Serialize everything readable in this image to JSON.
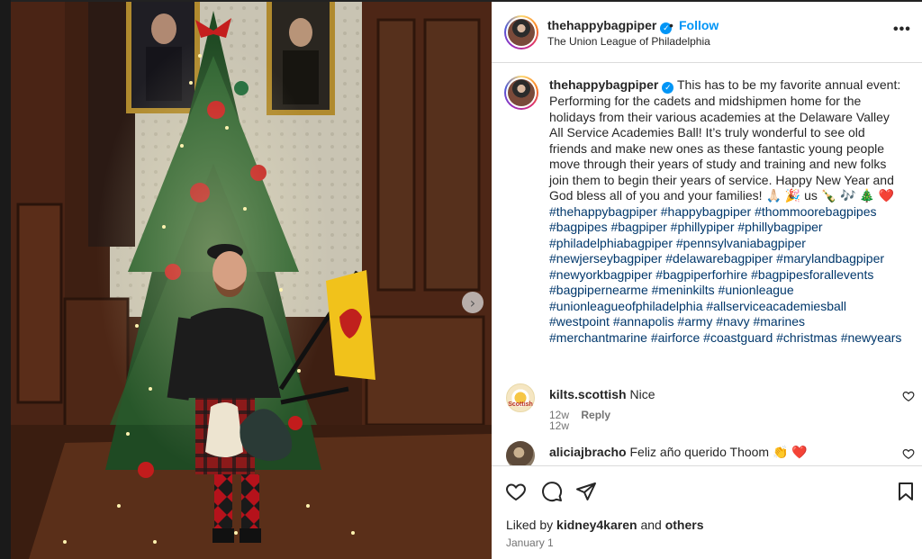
{
  "post": {
    "username": "thehappybagpiper",
    "verified_mark": "✓",
    "separator": "•",
    "follow_label": "Follow",
    "location": "The Union League of Philadelphia",
    "more_icon": "more-options-icon",
    "more_label": "•••",
    "next_label": "›"
  },
  "caption": {
    "username": "thehappybagpiper",
    "text": "This has to be my favorite annual event: Performing for the cadets and midshipmen home for the holidays from their various academies at the Delaware Valley All Service Academies Ball! It’s truly wonderful to see old friends and make new ones as these fantastic young people move through their years of study and training and new folks join them to begin their years of service. Happy New Year and God bless all of you and your families! 🙏🏻 🎉 us 🍾 🎶 🎄 ❤️",
    "hashtags": "#thehappybagpiper #happybagpiper #thommoorebagpipes #bagpipes #bagpiper #phillypiper #phillybagpiper #philadelphiabagpiper #pennsylvaniabagpiper #newjerseybagpiper #delawarebagpiper #marylandbagpiper #newyorkbagpiper #bagpiperforhire #bagpipesforallevents #bagpipernearme #meninkilts #unionleague #unionleagueofphiladelphia #allserviceacademiesball #westpoint #annapolis #army #navy #marines #merchantmarine #airforce #coastguard #christmas #newyears",
    "time": "12w"
  },
  "comments": [
    {
      "username": "kilts.scottish",
      "text": "Nice",
      "time": "12w",
      "reply_label": "Reply",
      "avatar_text": "Scottish"
    },
    {
      "username": "aliciajbracho",
      "text": "Feliz año querido Thoom 👏 ❤️"
    }
  ],
  "actions": {
    "liked_by_prefix": "Liked by",
    "liked_by_user": "kidney4karen",
    "liked_by_and": "and",
    "liked_by_others": "others",
    "date": "January 1"
  },
  "colors": {
    "accent": "#0095f6",
    "hashtag": "#00376b",
    "muted": "#737373",
    "border": "#dbdbdb",
    "heart_red": "#ed4956"
  }
}
